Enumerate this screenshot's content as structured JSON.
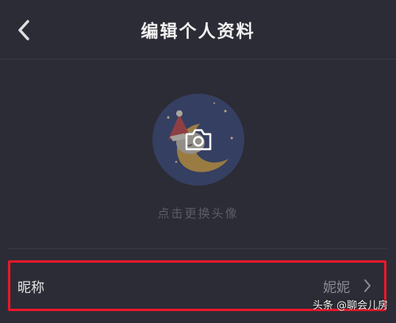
{
  "header": {
    "title": "编辑个人资料",
    "back_icon": "chevron-left-icon"
  },
  "avatar": {
    "camera_icon": "camera-icon",
    "caption": "点击更换头像"
  },
  "profile_fields": [
    {
      "label": "昵称",
      "value": "妮妮"
    }
  ],
  "watermark": "头条 @聊会儿房",
  "colors": {
    "background": "#2c2c36",
    "divider": "#3a3a45",
    "highlight": "#e8182a",
    "title": "#f2f2f2",
    "caption": "#5c5c68"
  }
}
